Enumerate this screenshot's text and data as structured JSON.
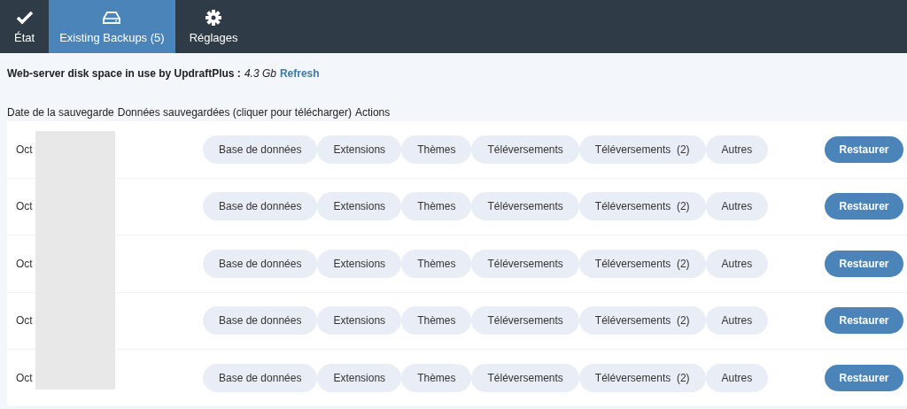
{
  "tabs": [
    {
      "label": "État",
      "selected": false
    },
    {
      "label": "Existing Backups (5)",
      "selected": true
    },
    {
      "label": "Réglages",
      "selected": false
    }
  ],
  "disk_usage": {
    "label": "Web-server disk space in use by UpdraftPlus :",
    "value": "4.3 Gb",
    "link": "Refresh"
  },
  "table": {
    "columns": [
      "Date de la sauvegarde",
      "Données sauvegardées (cliquer pour télécharger)",
      "Actions"
    ],
    "rows": [
      {
        "date": "Oct",
        "items": [
          "Base de données",
          "Extensions",
          "Thèmes",
          "Téléversements",
          "Téléversements  (2)",
          "Autres"
        ],
        "action": "Restaurer"
      },
      {
        "date": "Oct",
        "items": [
          "Base de données",
          "Extensions",
          "Thèmes",
          "Téléversements",
          "Téléversements  (2)",
          "Autres"
        ],
        "action": "Restaurer"
      },
      {
        "date": "Oct",
        "items": [
          "Base de données",
          "Extensions",
          "Thèmes",
          "Téléversements",
          "Téléversements  (2)",
          "Autres"
        ],
        "action": "Restaurer"
      },
      {
        "date": "Oct",
        "items": [
          "Base de données",
          "Extensions",
          "Thèmes",
          "Téléversements",
          "Téléversements  (2)",
          "Autres"
        ],
        "action": "Restaurer"
      },
      {
        "date": "Oct",
        "items": [
          "Base de données",
          "Extensions",
          "Thèmes",
          "Téléversements",
          "Téléversements  (2)",
          "Autres"
        ],
        "action": "Restaurer"
      }
    ]
  }
}
